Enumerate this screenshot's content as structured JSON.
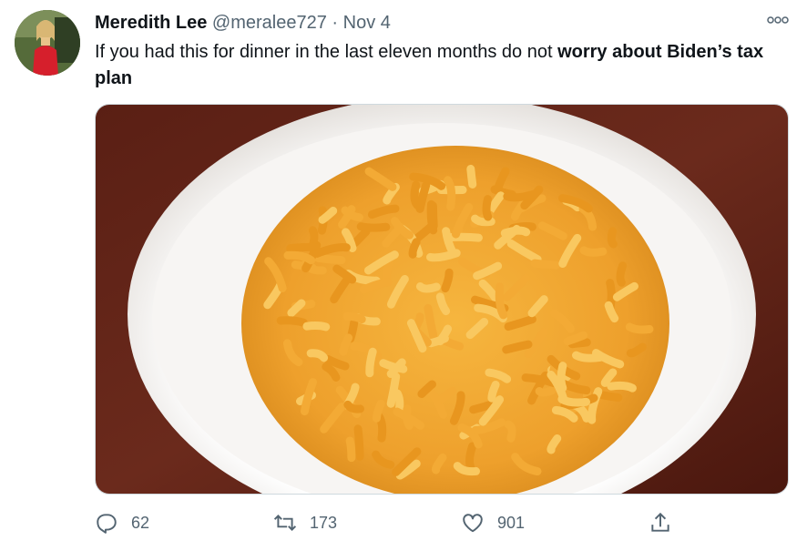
{
  "tweet": {
    "author_name": "Meredith Lee",
    "handle": "@meralee727",
    "separator": "·",
    "date": "Nov 4",
    "text_plain": "If you had this for dinner in the last eleven months do not ",
    "text_bold": "worry about Biden’s tax plan"
  },
  "icons": {
    "more": "more-options-icon",
    "reply": "reply-icon",
    "retweet": "retweet-icon",
    "like": "like-icon",
    "share": "share-icon"
  },
  "actions": {
    "reply_count": "62",
    "retweet_count": "173",
    "like_count": "901"
  },
  "colors": {
    "text": "#0f1419",
    "secondary": "#536471",
    "background": "#ffffff"
  }
}
